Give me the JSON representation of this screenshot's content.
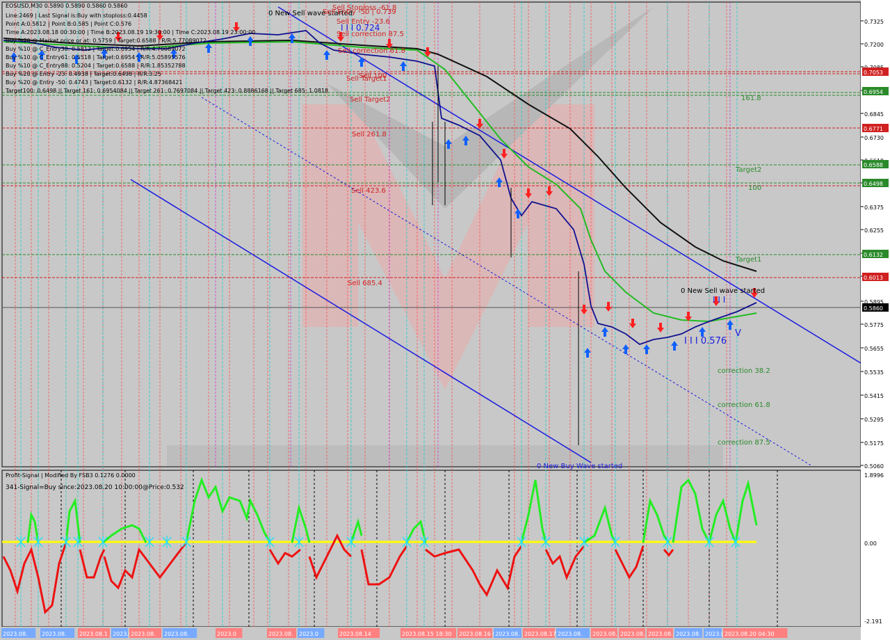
{
  "header": {
    "symbol_line": "EOSUSD,M30  0.5890 0.5890 0.5860 0.5860",
    "lines": [
      "Line:2469 | Last Signal is:Buy with stoploss:0.4458",
      "Point A:0.5812 | Point B:0.585 | Point C:0.576",
      "Time A:2023.08.18 00:30:00 | Time B:2023.08.19 19:30:00 | Time C:2023.08.19 23:00:00",
      "Buy %20 @ Market price or at: 0.5759 | Target:0.6588 | R/R:5.77089072",
      "Buy %10 @ C_Entry38: 0.5812 | Target:0.6954 | R/R:4.70089072",
      "Buy %10 @ C_Entry61: 0.5518 | Target:0.6954 | R/R:5.05895576",
      "Buy %10 @ C_Entry88: 0.5204 | Target:0.6588 | R/R:1.85352788",
      "Buy %20 @ Entry -23: 0.4938 | Target:0.6498 | R/R:3.25",
      "Buy %20 @ Entry -50: 0.4743 | Target:0.6132 | R/R:4.87368421",
      "Target100: 0.6498 || Target 161: 0.6954084 || Target 261: 0.7697084 || Target 423: 0.8886168 || Target 685: 1.0818"
    ]
  },
  "main_labels": {
    "new_sell_top": "0 New Sell wave started",
    "sell_stoploss": "Sell Stoploss -61.8",
    "sell_entry50": "Sell Entry -50 | 0.739",
    "sell_entry236": "Sell Entry -23.6",
    "wave_724": "I I I 0.724",
    "sell_corr875": "Sell correction 87.5",
    "sell_corr618": "Sell correction 61.8",
    "sell_100": "Sell 100",
    "sell_target1": "Sell Target1",
    "sell_target2": "Sell Target2",
    "sell_2618": "Sell 261.8",
    "sell_4236": "Sell 423.6",
    "sell_6854": "Sell 685.4",
    "lvl_1618": "161.8",
    "target2": "Target2",
    "lvl_100": "100",
    "target1": "Target1",
    "new_sell_right": "0 New Sell wave started",
    "wave_i": "I I I",
    "wave_576": "I I I 0.576",
    "wave_v": "V",
    "corr382": "correction 38.2",
    "corr618": "correction 61.8",
    "corr875": "correction 87.5",
    "new_buy": "0 New Buy Wave started"
  },
  "price_axis": {
    "ticks": [
      "0.7325",
      "0.7200",
      "0.7085",
      "0.6965",
      "0.6845",
      "0.6730",
      "0.6610",
      "0.6495",
      "0.6375",
      "0.6255",
      "0.6135",
      "0.6015",
      "0.5895",
      "0.5775",
      "0.5655",
      "0.5535",
      "0.5415",
      "0.5295",
      "0.5175",
      "0.5060"
    ],
    "tags": [
      {
        "text": "0.7053",
        "color": "#d02020"
      },
      {
        "text": "0.6954",
        "color": "#2a8a2a"
      },
      {
        "text": "0.6771",
        "color": "#d02020"
      },
      {
        "text": "0.6588",
        "color": "#2a8a2a"
      },
      {
        "text": "0.6498",
        "color": "#2a8a2a"
      },
      {
        "text": "0.6132",
        "color": "#2a8a2a"
      },
      {
        "text": "0.6013",
        "color": "#d02020"
      },
      {
        "text": "0.5860",
        "color": "#000000"
      }
    ]
  },
  "indicator": {
    "title": "Profit-Signal | Modified By FSB3 0.1276 0.0000",
    "signal": "341-Signal=Buy since:2023.08.20 10:00:00@Price:0.532",
    "ticks": [
      "1.8996",
      "0.00",
      "-2.191"
    ]
  },
  "time_axis": [
    "2023.08.",
    "2023.08.",
    "2023.08.1",
    "2023.08.",
    "2023.08.",
    "2023.08.",
    "2023.0",
    "2023.08.",
    "2023.0",
    "2023.08.14",
    "2023.08.15 18:30",
    "2023.08.16 09:00",
    "2023.08.",
    "2023.08.17",
    "2023.08.",
    "2023.08.",
    "2023.08.",
    "2023.08.",
    "2023.08.",
    "2023.08.",
    "2023.08.20 04:30"
  ],
  "colors": {
    "bg": "#c8c8c8",
    "ema_black": "#111111",
    "ema_green": "#22bb22",
    "price_blue": "#101090",
    "channel": "#1a1ae0",
    "signal_green": "#22ee22",
    "signal_red": "#ee1111",
    "zero_line": "#ffff00",
    "red_vline": "#ff5050",
    "cyan_vline": "#22cccc",
    "magenta_vline": "#cc22cc"
  }
}
